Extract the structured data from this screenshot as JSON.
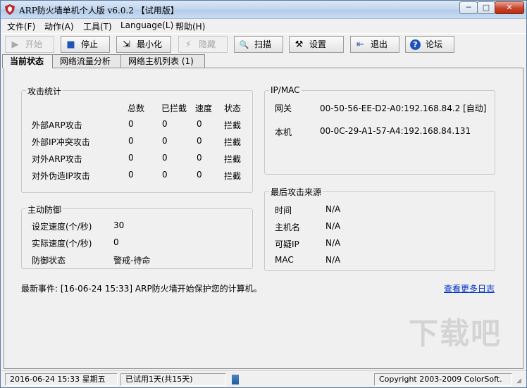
{
  "window": {
    "title": "ARP防火墙单机个人版 v6.0.2 【试用版】",
    "controls": {
      "minimize": "─",
      "maximize": "□",
      "close": "✕"
    }
  },
  "menu": [
    {
      "label": "文件(F)"
    },
    {
      "label": "动作(A)"
    },
    {
      "label": "工具(T)"
    },
    {
      "label": "Language(L)"
    },
    {
      "label": "帮助(H)"
    }
  ],
  "toolbar": [
    {
      "label": "开始",
      "icon": "play-icon",
      "glyph": "▶",
      "enabled": false
    },
    {
      "label": "停止",
      "icon": "stop-icon",
      "glyph": "■",
      "enabled": true
    },
    {
      "label": "最小化",
      "icon": "minimize-icon",
      "glyph": "⇲",
      "enabled": true
    },
    {
      "label": "隐藏",
      "icon": "hide-icon",
      "glyph": "⚡",
      "enabled": false
    },
    {
      "label": "扫描",
      "icon": "magnifier-icon",
      "glyph": "🔍",
      "enabled": true
    },
    {
      "label": "设置",
      "icon": "settings-icon",
      "glyph": "⚒",
      "enabled": true
    },
    {
      "label": "退出",
      "icon": "exit-icon",
      "glyph": "⇤",
      "enabled": true
    },
    {
      "label": "论坛",
      "icon": "help-icon",
      "glyph": "?",
      "enabled": true
    }
  ],
  "tabs": [
    {
      "label": "当前状态",
      "active": true
    },
    {
      "label": "网络流量分析",
      "active": false
    },
    {
      "label": "网络主机列表 (1)",
      "active": false
    }
  ],
  "attack_stats": {
    "title": "攻击统计",
    "headers": [
      "总数",
      "已拦截",
      "速度",
      "状态"
    ],
    "rows": [
      {
        "name": "外部ARP攻击",
        "total": "0",
        "blocked": "0",
        "speed": "0",
        "state": "拦截"
      },
      {
        "name": "外部IP冲突攻击",
        "total": "0",
        "blocked": "0",
        "speed": "0",
        "state": "拦截"
      },
      {
        "name": "对外ARP攻击",
        "total": "0",
        "blocked": "0",
        "speed": "0",
        "state": "拦截"
      },
      {
        "name": "对外伪造IP攻击",
        "total": "0",
        "blocked": "0",
        "speed": "0",
        "state": "拦截"
      }
    ]
  },
  "ipmac": {
    "title": "IP/MAC",
    "gateway_label": "网关",
    "gateway_value": "00-50-56-EE-D2-A0:192.168.84.2 [自动]",
    "local_label": "本机",
    "local_value": "00-0C-29-A1-57-A4:192.168.84.131"
  },
  "defense": {
    "title": "主动防御",
    "rows": [
      {
        "label": "设定速度(个/秒)",
        "value": "30"
      },
      {
        "label": "实际速度(个/秒)",
        "value": "0"
      },
      {
        "label": "防御状态",
        "value": "警戒-待命"
      }
    ]
  },
  "last_attack": {
    "title": "最后攻击来源",
    "rows": [
      {
        "label": "时间",
        "value": "N/A"
      },
      {
        "label": "主机名",
        "value": "N/A"
      },
      {
        "label": "可疑IP",
        "value": "N/A"
      },
      {
        "label": "MAC",
        "value": "N/A"
      }
    ]
  },
  "event": {
    "text": "最新事件: [16-06-24 15:33] ARP防火墙开始保护您的计算机。",
    "link": "查看更多日志"
  },
  "statusbar": {
    "datetime": "2016-06-24 15:33 星期五",
    "trial": "已试用1天(共15天)",
    "copyright": "Copyright 2003-2009 ColorSoft."
  },
  "watermark": "下载吧",
  "colors": {
    "link": "#0033cc",
    "title_gradient_top": "#dbe7f5",
    "close_red": "#c8442a"
  }
}
